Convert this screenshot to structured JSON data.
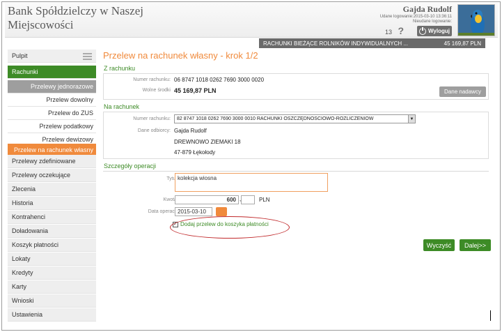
{
  "header": {
    "bank_name": "Bank Spółdzielczy w Naszej Miejscowości",
    "user_name": "Gajda Rudolf",
    "last_login_ok": "Udane logowanie:2015-03-10 13:36:11",
    "last_login_fail": "Nieudane logowanie:",
    "message_count": "13",
    "help": "?",
    "logout_label": "Wyloguj"
  },
  "account_bar": {
    "name": "RACHUNKI BIEŻĄCE ROLNIKÓW INDYWIDUALNYCH ...",
    "balance": "45 169,87 PLN"
  },
  "sidebar": {
    "items": [
      {
        "label": "Pulpit"
      },
      {
        "label": "Rachunki"
      },
      {
        "label": "Przelewy jednorazowe"
      },
      {
        "label": "Przelew dowolny"
      },
      {
        "label": "Przelew do ZUS"
      },
      {
        "label": "Przelew podatkowy"
      },
      {
        "label": "Przelew dewizowy"
      },
      {
        "label": "Przelew na rachunek własny"
      },
      {
        "label": "Przelewy zdefiniowane"
      },
      {
        "label": "Przelewy oczekujące"
      },
      {
        "label": "Zlecenia"
      },
      {
        "label": "Historia"
      },
      {
        "label": "Kontrahenci"
      },
      {
        "label": "Doładowania"
      },
      {
        "label": "Koszyk płatności"
      },
      {
        "label": "Lokaty"
      },
      {
        "label": "Kredyty"
      },
      {
        "label": "Karty"
      },
      {
        "label": "Wnioski"
      },
      {
        "label": "Ustawienia"
      }
    ]
  },
  "main": {
    "title": "Przelew na rachunek własny - krok 1/2",
    "from": {
      "section": "Z rachunku",
      "account_label": "Numer rachunku:",
      "account_value": "06 8747 1018 0262 7690 3000 0020",
      "funds_label": "Wolne środki",
      "funds_value": "45 169,87 PLN",
      "sender_btn": "Dane nadawcy"
    },
    "to": {
      "section": "Na rachunek",
      "account_label": "Numer rachunku:",
      "account_value": "82 8747 1018 0262 7690 3000 0010 RACHUNKI OSZCZĘDNOŚCIOWO-ROZLICZENIOW",
      "recipient_label": "Dane odbiorcy:",
      "recipient_line1": "Gajda Rudolf",
      "recipient_line2": "DREWNOWO ZIEMAKI 18",
      "recipient_line3": "47-879 Łękołody"
    },
    "details": {
      "section": "Szczegóły operacji",
      "title_label": "Tytuł:",
      "title_value": "kolekcja wiosna",
      "amount_label": "Kwota:",
      "amount_value": "600",
      "amount_sep": ",",
      "currency": "PLN",
      "date_label": "Data operacji:",
      "date_value": "2015-03-10",
      "basket_label": "Dodaj przelew do koszyka płatności",
      "basket_checked": "✓"
    },
    "buttons": {
      "clear": "Wyczyść",
      "next": "Dalej>>"
    }
  },
  "colors": {
    "accent_green": "#3d8b26",
    "accent_orange": "#f08a3c",
    "highlight_red": "#c0282a"
  }
}
